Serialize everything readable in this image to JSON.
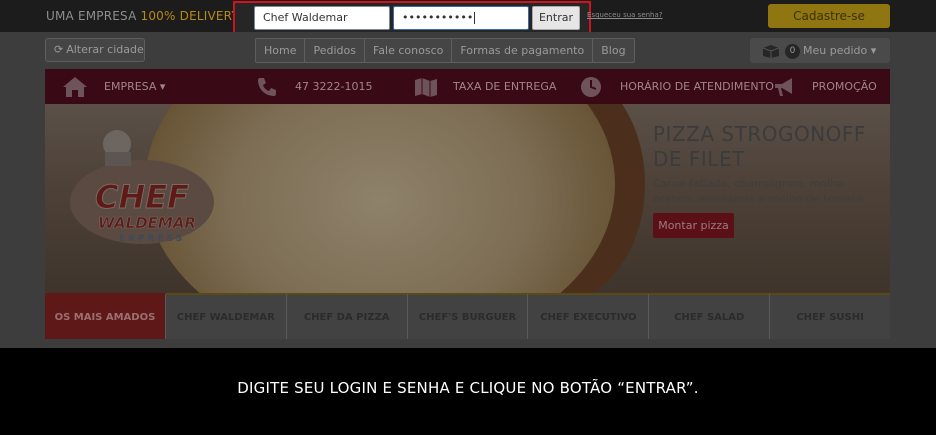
{
  "topbar": {
    "brand_prefix": "UMA EMPRESA ",
    "brand_highlight": "100% DELIVERY",
    "username_value": "Chef Waldemar",
    "password_value": "•••••••••••",
    "login_button": "Entrar",
    "forgot_password": "Esqueceu sua senha?",
    "signup_button": "Cadastre-se"
  },
  "subnav": {
    "change_city": "Alterar cidade",
    "menu": [
      "Home",
      "Pedidos",
      "Fale conosco",
      "Formas de pagamento",
      "Blog"
    ],
    "cart_count": "0",
    "cart_label": "Meu pedido"
  },
  "infobar": {
    "items": [
      "EMPRESA ▾",
      "47 3222-1015",
      "TAXA DE ENTREGA",
      "HORÁRIO DE ATENDIMENTO",
      "PROMOÇÃO"
    ]
  },
  "banner": {
    "logo_line1": "CHEF",
    "logo_line2": "WALDEMAR",
    "logo_line3": "EXPRESS",
    "title": "PIZZA STROGONOFF DE FILET",
    "description": "Carne fatiada, champignon, molho branco, mussarela e molho de tomate",
    "button": "Montar pizza"
  },
  "categories": [
    "OS MAIS AMADOS",
    "CHEF WALDEMAR",
    "CHEF DA PIZZA",
    "CHEF'S BURGUER",
    "CHEF EXECUTIVO",
    "CHEF SALAD",
    "CHEF SUSHI"
  ],
  "instruction": "DIGITE SEU LOGIN E SENHA E CLIQUE NO BOTÃO “ENTRAR”.",
  "colors": {
    "highlight_border": "#d0141b",
    "brand_gold": "#b48a18",
    "infobar_maroon": "#3a0916",
    "active_category": "#5e1818"
  }
}
